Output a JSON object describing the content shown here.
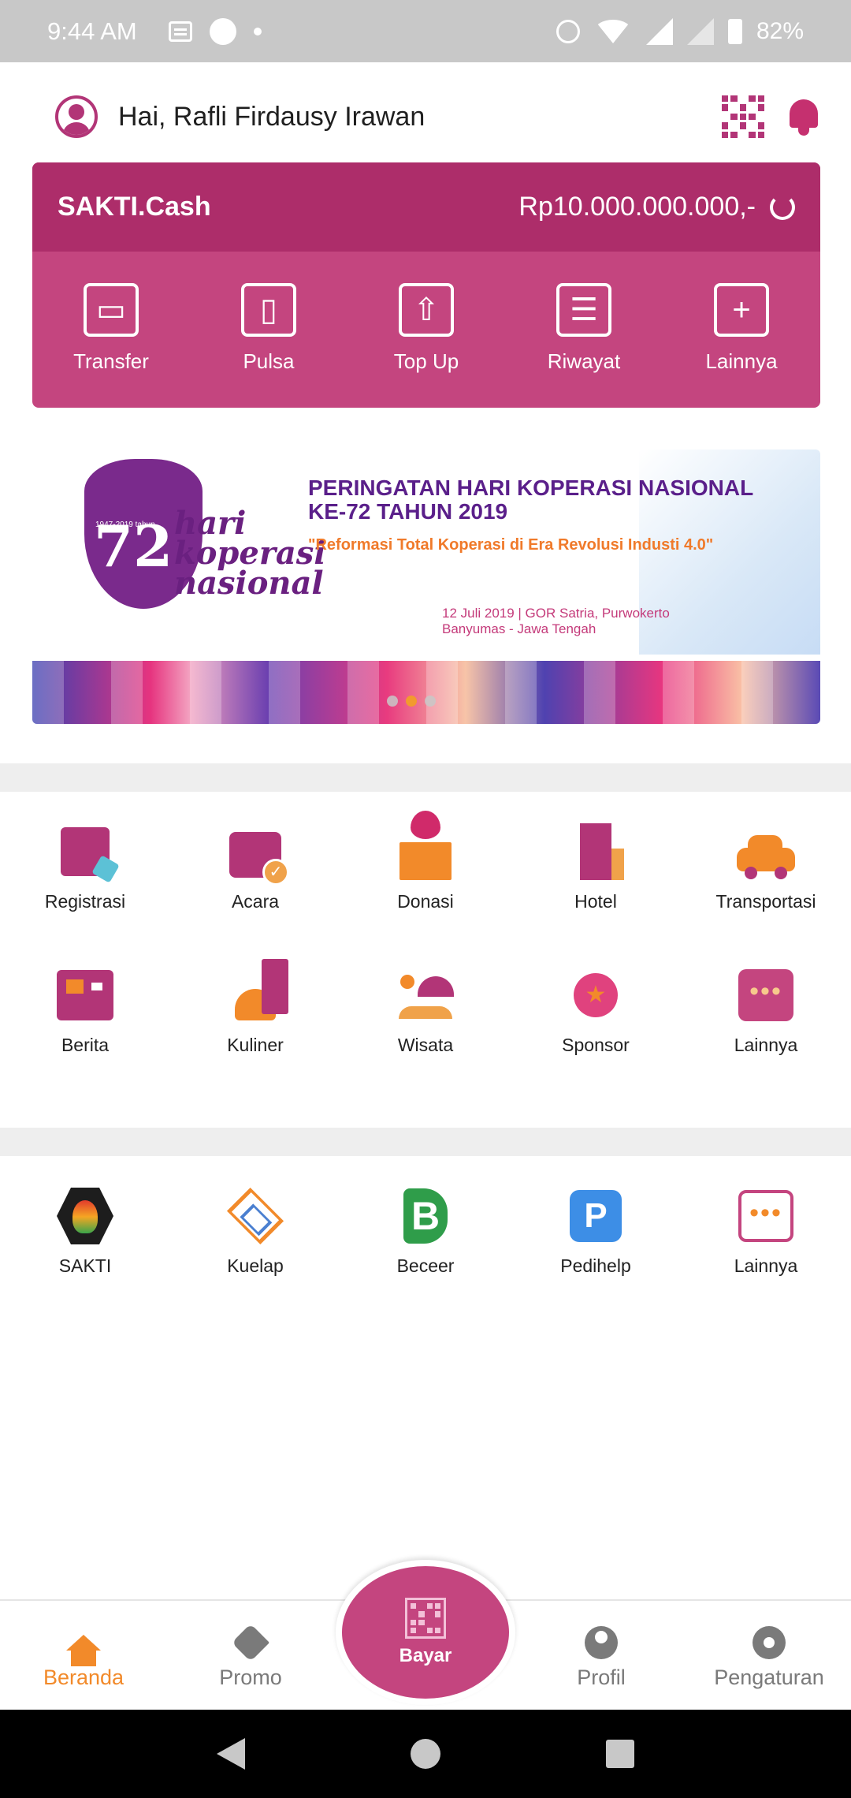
{
  "status_bar": {
    "time": "9:44 AM",
    "battery": "82%"
  },
  "header": {
    "greeting": "Hai, Rafli Firdausy Irawan"
  },
  "wallet": {
    "name": "SAKTI.Cash",
    "balance": "Rp10.000.000.000,-",
    "actions": [
      {
        "label": "Transfer",
        "icon": "transfer-icon"
      },
      {
        "label": "Pulsa",
        "icon": "phone-icon"
      },
      {
        "label": "Top Up",
        "icon": "top-up-icon"
      },
      {
        "label": "Riwayat",
        "icon": "history-icon"
      },
      {
        "label": "Lainnya",
        "icon": "plus-icon"
      }
    ]
  },
  "banner": {
    "logo_number": "72",
    "logo_text": "hari koperasi nasional",
    "logo_sub": "1947-2019 tahun",
    "title": "PERINGATAN HARI KOPERASI NASIONAL KE-72 TAHUN 2019",
    "slogan": "\"Reformasi Total Koperasi di Era Revolusi Industi 4.0\"",
    "place_line1": "12 Juli 2019 | GOR Satria, Purwokerto",
    "place_line2": "Banyumas - Jawa Tengah",
    "carousel_active_index": 1,
    "carousel_count": 3
  },
  "services": [
    {
      "label": "Registrasi",
      "icon": "registration-icon"
    },
    {
      "label": "Acara",
      "icon": "calendar-icon"
    },
    {
      "label": "Donasi",
      "icon": "donation-icon"
    },
    {
      "label": "Hotel",
      "icon": "hotel-icon"
    },
    {
      "label": "Transportasi",
      "icon": "car-icon"
    },
    {
      "label": "Berita",
      "icon": "news-icon"
    },
    {
      "label": "Kuliner",
      "icon": "food-icon"
    },
    {
      "label": "Wisata",
      "icon": "beach-icon"
    },
    {
      "label": "Sponsor",
      "icon": "sponsor-badge-icon"
    },
    {
      "label": "Lainnya",
      "icon": "more-icon"
    }
  ],
  "partners": [
    {
      "label": "SAKTI",
      "icon": "sakti-logo-icon"
    },
    {
      "label": "Kuelap",
      "icon": "kuelap-logo-icon"
    },
    {
      "label": "Beceer",
      "icon": "beceer-logo-icon"
    },
    {
      "label": "Pedihelp",
      "icon": "pedihelp-logo-icon"
    },
    {
      "label": "Lainnya",
      "icon": "more-icon"
    }
  ],
  "bottom_nav": {
    "items": [
      {
        "label": "Beranda",
        "icon": "home-icon",
        "active": true
      },
      {
        "label": "Promo",
        "icon": "tag-icon",
        "active": false
      },
      {
        "label": "Profil",
        "icon": "person-icon",
        "active": false
      },
      {
        "label": "Pengaturan",
        "icon": "gear-icon",
        "active": false
      }
    ],
    "center": {
      "label": "Bayar",
      "icon": "qr-scan-icon"
    }
  },
  "colors": {
    "brand": "#b23577",
    "wallet_top": "#ad2d6a",
    "wallet_body": "#c4457f",
    "accent": "#f28a2a",
    "inactive": "#7a7a7a"
  }
}
